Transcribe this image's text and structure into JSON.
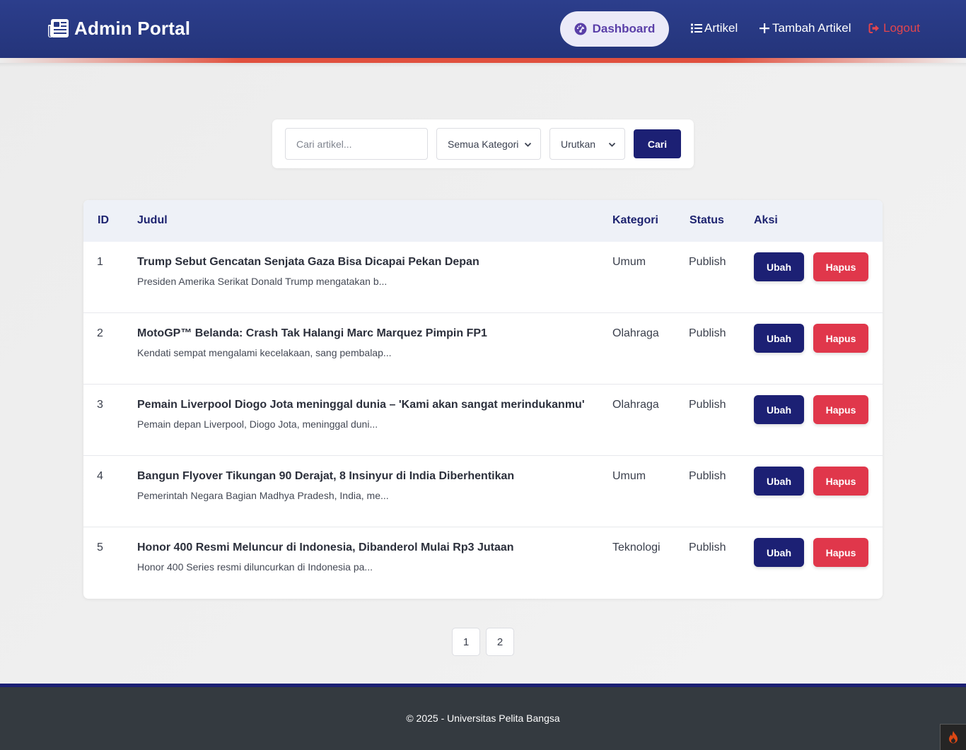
{
  "header": {
    "brand": "Admin Portal",
    "brand_icon": "newspaper-icon",
    "nav": {
      "dashboard": "Dashboard",
      "artikel": "Artikel",
      "tambah_artikel": "Tambah Artikel",
      "logout": "Logout"
    },
    "colors": {
      "bar": "#2a3b88",
      "accent": "#e0503e",
      "logout": "#e2454d",
      "dashboard_text": "#5a3fa8"
    }
  },
  "search": {
    "placeholder": "Cari artikel...",
    "value": "",
    "kategori_selected": "Semua Kategori",
    "urutkan_selected": "Urutkan",
    "button": "Cari"
  },
  "table": {
    "headers": {
      "id": "ID",
      "judul": "Judul",
      "kategori": "Kategori",
      "status": "Status",
      "aksi": "Aksi"
    },
    "rows": [
      {
        "id": "1",
        "title": "Trump Sebut Gencatan Senjata Gaza Bisa Dicapai Pekan Depan",
        "excerpt": "Presiden Amerika Serikat Donald Trump mengatakan b...",
        "kategori": "Umum",
        "status": "Publish",
        "edit": "Ubah",
        "delete": "Hapus"
      },
      {
        "id": "2",
        "title": "MotoGP™ Belanda: Crash Tak Halangi Marc Marquez Pimpin FP1",
        "excerpt": "Kendati sempat mengalami kecelakaan, sang pembalap...",
        "kategori": "Olahraga",
        "status": "Publish",
        "edit": "Ubah",
        "delete": "Hapus"
      },
      {
        "id": "3",
        "title": "Pemain Liverpool Diogo Jota meninggal dunia – 'Kami akan sangat merindukanmu'",
        "excerpt": "Pemain depan Liverpool, Diogo Jota, meninggal duni...",
        "kategori": "Olahraga",
        "status": "Publish",
        "edit": "Ubah",
        "delete": "Hapus"
      },
      {
        "id": "4",
        "title": "Bangun Flyover Tikungan 90 Derajat, 8 Insinyur di India Diberhentikan",
        "excerpt": "Pemerintah Negara Bagian Madhya Pradesh, India, me...",
        "kategori": "Umum",
        "status": "Publish",
        "edit": "Ubah",
        "delete": "Hapus"
      },
      {
        "id": "5",
        "title": "Honor 400 Resmi Meluncur di Indonesia, Dibanderol Mulai Rp3 Jutaan",
        "excerpt": "Honor 400 Series resmi diluncurkan di Indonesia pa...",
        "kategori": "Teknologi",
        "status": "Publish",
        "edit": "Ubah",
        "delete": "Hapus"
      }
    ],
    "colors": {
      "edit": "#1c2074",
      "delete": "#e0374b"
    }
  },
  "pagination": {
    "pages": [
      "1",
      "2"
    ]
  },
  "footer": {
    "text": "© 2025 - Universitas Pelita Bangsa"
  }
}
